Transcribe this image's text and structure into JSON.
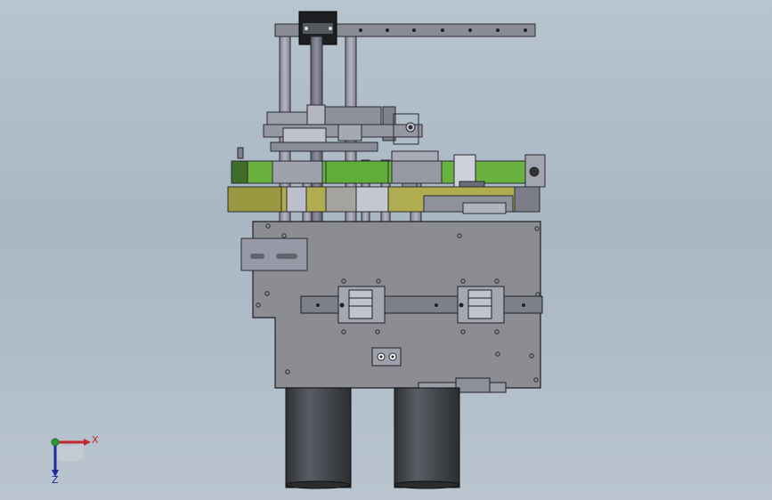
{
  "viewport": {
    "background_top": "#b8c4cf",
    "background_bottom": "#b9c4ce"
  },
  "model": {
    "icon": "mechanical-assembly",
    "plate_color": "#8d8f95",
    "rod_color": "#9a9ca8",
    "green_belt_color": "#5fae3a",
    "yellow_belt_color": "#a8a64a",
    "cylinder_color": "#3d3f45"
  },
  "triad": {
    "x_label": "X",
    "z_label": "Z",
    "x_color": "#c0282d",
    "y_color": "#2f9a35",
    "z_color": "#1d2b9c"
  }
}
